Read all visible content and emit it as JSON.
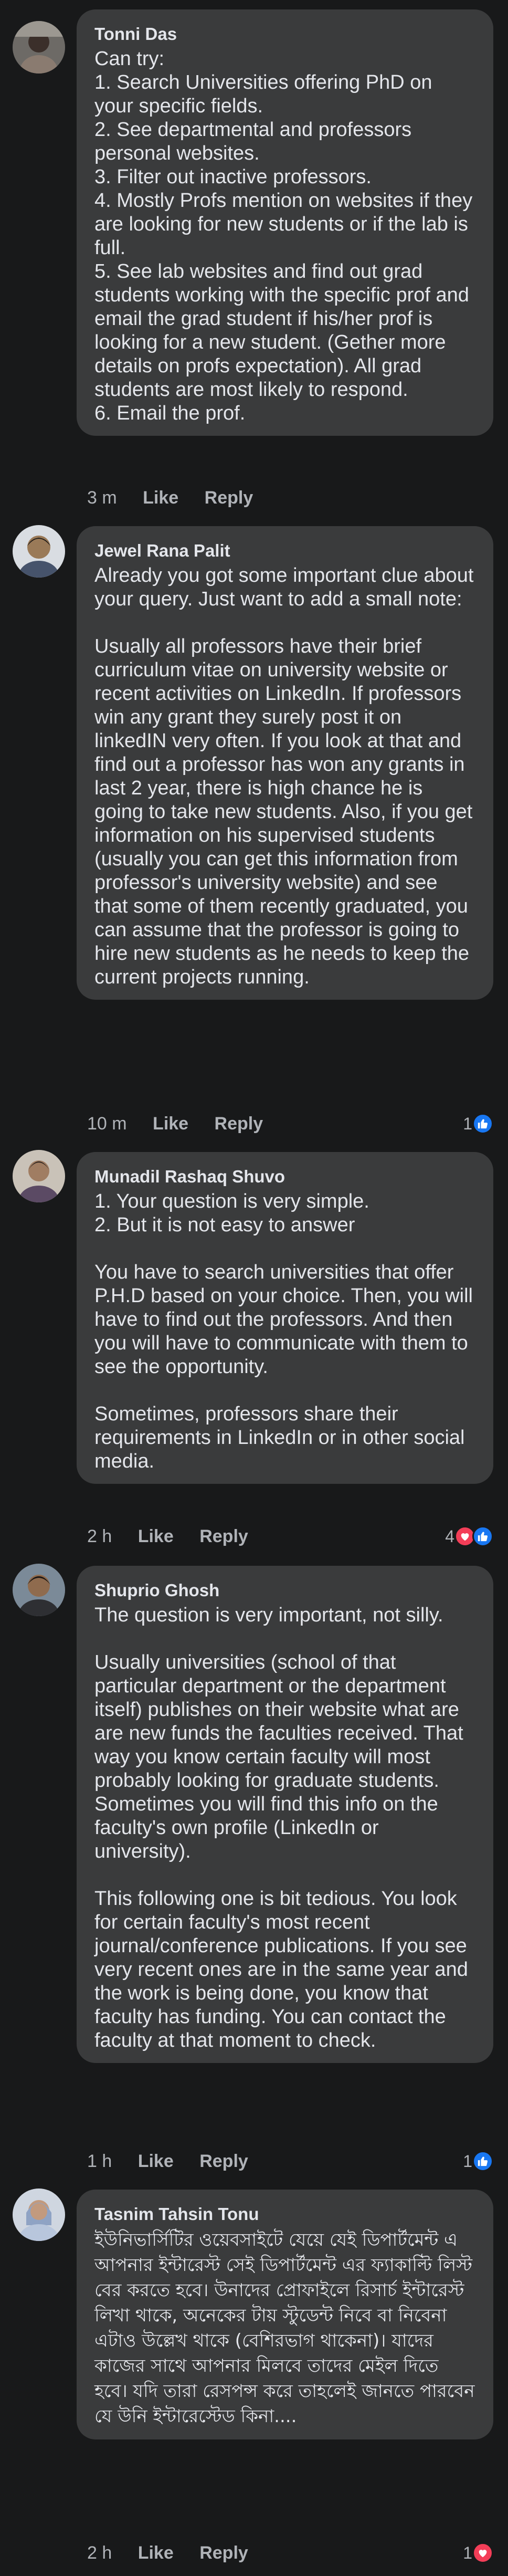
{
  "comments": [
    {
      "author": "Tonni Das",
      "text": "Can try:\n1. Search Universities offering PhD on your specific fields.\n2. See departmental and professors personal websites.\n3. Filter out inactive professors.\n4. Mostly Profs mention on websites if they are looking for new students or if the lab is full.\n5. See lab websites and find out grad students working with the specific prof and email the grad student if his/her prof is looking for a new student. (Gether more details on profs expectation). All grad students are most likely to respond.\n6. Email the prof.",
      "time": "3 m",
      "like_label": "Like",
      "reply_label": "Reply"
    },
    {
      "author": "Jewel Rana Palit",
      "text": "Already you got some important clue about your query. Just want to add a small note:\n\nUsually all professors have their brief curriculum vitae on university website or recent activities on LinkedIn. If professors win any grant they surely post it on linkedIN very often. If you look at that and find out a professor has won any grants in last 2 year, there is high chance he is going to take new students. Also, if you get information on his supervised students (usually you can get this information from professor's university website) and see that some of them recently graduated, you can assume that the professor is going to hire new students as he needs to keep the current projects running.",
      "time": "10 m",
      "like_label": "Like",
      "reply_label": "Reply",
      "reaction_count": "1"
    },
    {
      "author": "Munadil Rashaq Shuvo",
      "text": "1. Your question is very simple.\n2. But it is not easy to answer\n\nYou have to search universities that offer P.H.D based on your choice. Then, you will have to find out the professors. And then you will have to communicate with them to see the opportunity.\n\nSometimes, professors share their requirements in LinkedIn or in other social media.",
      "time": "2 h",
      "like_label": "Like",
      "reply_label": "Reply",
      "reaction_count": "4"
    },
    {
      "author": "Shuprio Ghosh",
      "text": "The question is very important, not silly.\n\nUsually universities (school of that particular department or the department itself) publishes on their website what are are new funds the faculties received. That way you know certain faculty will most probably looking for graduate students. Sometimes you will find this info on the faculty's own profile (LinkedIn or university).\n\nThis following one is bit tedious. You look for certain faculty's most recent journal/conference publications. If you see very recent ones are in the same year and the work is being done, you know that faculty has funding. You can contact the faculty at that moment to check.",
      "time": "1 h",
      "like_label": "Like",
      "reply_label": "Reply",
      "reaction_count": "1"
    },
    {
      "author": "Tasnim Tahsin Tonu",
      "text": "ইউনিভার্সিটির ওয়েবসাইটে যেয়ে যেই ডিপার্টমেন্ট এ আপনার ইন্টারেস্ট সেই ডিপার্টমেন্ট এর ফ্যাকাল্টি লিস্ট বের করতে হবে। উনাদের প্রোফাইলে রিসার্চ ইন্টারেস্ট লিখা থাকে, অনেকের টায় স্টুডেন্ট নিবে বা নিবেনা এটাও উল্লেখ থাকে (বেশিরভাগ থাকেনা)। যাদের কাজের সাথে আপনার মিলবে তাদের মেইল দিতে হবে। যদি তারা রেসপন্স করে তাহলেই জানতে পারবেন যে উনি ইন্টারেস্টেড কিনা....",
      "time": "2 h",
      "like_label": "Like",
      "reply_label": "Reply",
      "reaction_count": "1"
    }
  ],
  "colors": {
    "background": "#18191a",
    "bubble": "#3a3b3c",
    "text": "#e4e6eb",
    "secondary": "#b0b3b8",
    "like": "#1877f2",
    "love": "#f33e58"
  },
  "icons": {
    "like": "thumbs-up-icon",
    "love": "heart-icon"
  }
}
